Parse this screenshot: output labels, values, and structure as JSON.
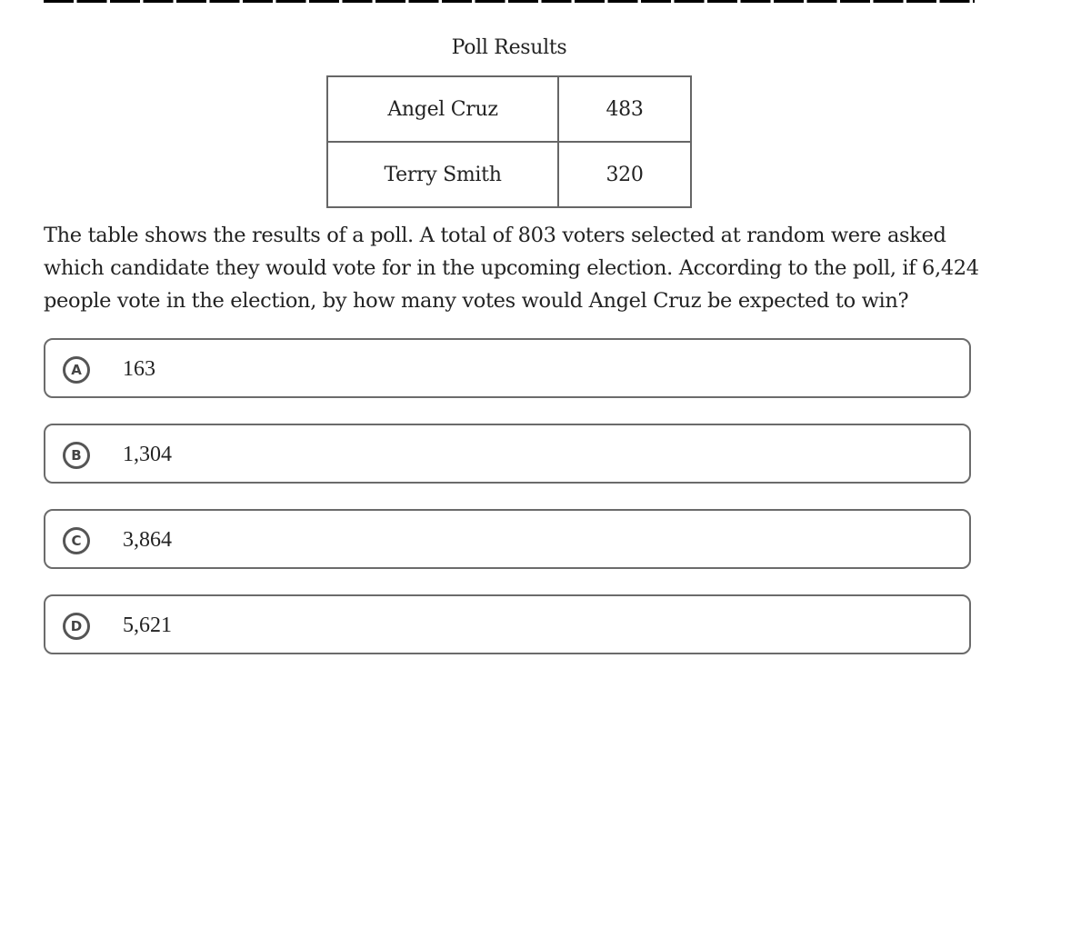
{
  "table": {
    "title": "Poll Results",
    "rows": [
      {
        "candidate": "Angel Cruz",
        "votes": "483"
      },
      {
        "candidate": "Terry Smith",
        "votes": "320"
      }
    ]
  },
  "question": {
    "text": "The table shows the results of a poll. A total of 803 voters selected at random were asked which candidate they would vote for in the upcoming election. According to the poll, if 6,424 people vote in the election, by how many votes would Angel Cruz be expected to win?"
  },
  "choices": [
    {
      "letter": "A",
      "text": "163"
    },
    {
      "letter": "B",
      "text": "1,304"
    },
    {
      "letter": "C",
      "text": "3,864"
    },
    {
      "letter": "D",
      "text": "5,621"
    }
  ]
}
